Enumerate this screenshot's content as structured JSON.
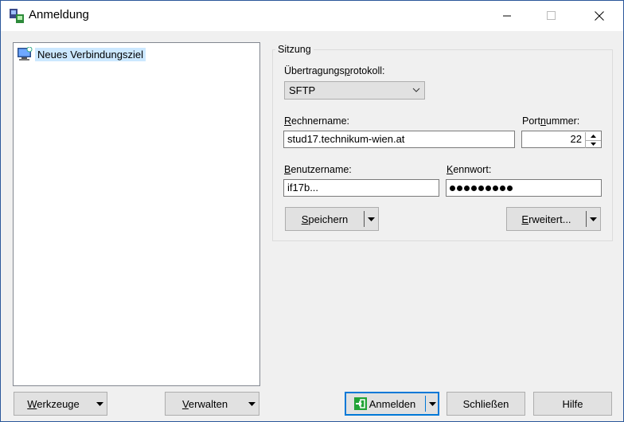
{
  "window": {
    "title": "Anmeldung",
    "minimize": "minimize-icon",
    "maximize": "maximize-icon",
    "close": "close-icon"
  },
  "tree": {
    "items": [
      {
        "label": "Neues Verbindungsziel",
        "icon": "computer-icon"
      }
    ]
  },
  "session": {
    "group_label": "Sitzung",
    "protocol_label_pre": "Übertragungs",
    "protocol_label_key": "p",
    "protocol_label_post": "rotokoll:",
    "protocol_value": "SFTP",
    "host_label_key": "R",
    "host_label_post": "echnername:",
    "host_value": "stud17.technikum-wien.at",
    "port_label_pre": "Port",
    "port_label_key": "n",
    "port_label_post": "ummer:",
    "port_value": "22",
    "user_label_key": "B",
    "user_label_post": "enutzername:",
    "user_value": "if17b...",
    "pass_label_key": "K",
    "pass_label_post": "ennwort:",
    "pass_dots": 9,
    "save_key": "S",
    "save_post": "peichern",
    "advanced_key": "E",
    "advanced_post": "rweitert..."
  },
  "footer": {
    "tools_key": "W",
    "tools_post": "erkzeuge",
    "manage_key": "V",
    "manage_post": "erwalten",
    "login_label": "Anmelden",
    "close_label": "Schließen",
    "help_label": "Hilfe"
  },
  "colors": {
    "accent": "#0078d7",
    "tree_selection": "#cce8ff",
    "login_icon": "#21a336"
  }
}
